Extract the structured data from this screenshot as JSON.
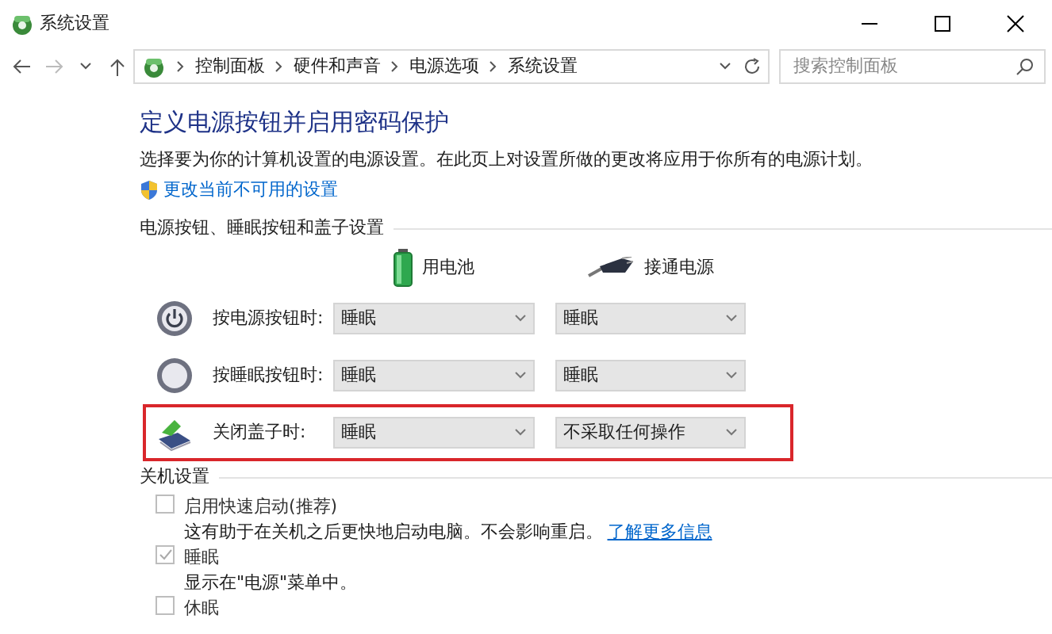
{
  "window": {
    "title": "系统设置"
  },
  "address_bar": {
    "breadcrumbs": [
      "控制面板",
      "硬件和声音",
      "电源选项",
      "系统设置"
    ],
    "search_placeholder": "搜索控制面板"
  },
  "content": {
    "heading": "定义电源按钮并启用密码保护",
    "description": "选择要为你的计算机设置的电源设置。在此页上对设置所做的更改将应用于你所有的电源计划。",
    "change_link": "更改当前不可用的设置"
  },
  "power_section": {
    "title": "电源按钮、睡眠按钮和盖子设置",
    "columns": [
      {
        "label": "用电池",
        "kind": "battery"
      },
      {
        "label": "接通电源",
        "kind": "plug"
      }
    ],
    "rows": [
      {
        "kind": "power",
        "label": "按电源按钮时:",
        "values": [
          "睡眠",
          "睡眠"
        ],
        "highlighted": false
      },
      {
        "kind": "sleep",
        "label": "按睡眠按钮时:",
        "values": [
          "睡眠",
          "睡眠"
        ],
        "highlighted": false
      },
      {
        "kind": "lid",
        "label": "关闭盖子时:",
        "values": [
          "睡眠",
          "不采取任何操作"
        ],
        "highlighted": true
      }
    ]
  },
  "shutdown_section": {
    "title": "关机设置",
    "options": [
      {
        "label": "启用快速启动(推荐)",
        "checked": false,
        "disabled": true,
        "description": "这有助于在关机之后更快地启动电脑。不会影响重启。",
        "link": "了解更多信息"
      },
      {
        "label": "睡眠",
        "checked": true,
        "disabled": true,
        "description": "显示在\"电源\"菜单中。"
      },
      {
        "label": "休眠",
        "checked": false,
        "disabled": true
      }
    ]
  }
}
